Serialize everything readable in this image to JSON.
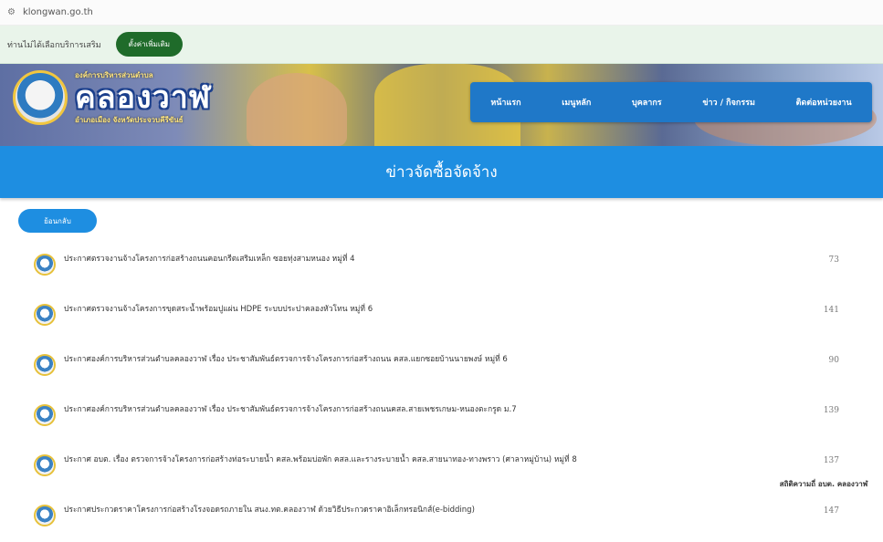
{
  "browser": {
    "url": "klongwan.go.th"
  },
  "notice": {
    "text": "ท่านไม่ได้เลือกบริการเสริม",
    "button": "ตั้งค่าเพิ่มเติม"
  },
  "header": {
    "org_small": "องค์การบริหารส่วนตำบล",
    "org_big": "คลองวาฬ",
    "org_sub": "อำเภอเมือง จังหวัดประจวบคีรีขันธ์"
  },
  "nav": [
    "หน้าแรก",
    "เมนูหลัก",
    "บุคลากร",
    "ข่าว / กิจกรรม",
    "ติดต่อหน่วยงาน"
  ],
  "page": {
    "title": "ข่าวจัดซื้อจัดจ้าง",
    "back_label": "ย้อนกลับ"
  },
  "items": [
    {
      "title": "ประกาศตรวจงานจ้างโครงการก่อสร้างถนนคอนกรีตเสริมเหล็ก ซอยทุ่งสามหนอง หมู่ที่ 4",
      "views": "73"
    },
    {
      "title": "ประกาศตรวจงานจ้างโครงการขุดสระน้ำพร้อมปูแผ่น HDPE ระบบประปาคลองหัวโทน หมู่ที่ 6",
      "views": "141"
    },
    {
      "title": "ประกาศองค์การบริหารส่วนตำบลคลองวาฬ เรื่อง ประชาสัมพันธ์ตรวจการจ้างโครงการก่อสร้างถนน คสล.แยกซอยบ้านนายพงษ์ หมู่ที่ 6",
      "views": "90"
    },
    {
      "title": "ประกาศองค์การบริหารส่วนตำบลคลองวาฬ เรื่อง ประชาสัมพันธ์ตรวจการจ้างโครงการก่อสร้างถนนคสล.สายเพชรเกษม-หนองตะกรูด ม.7",
      "views": "139"
    },
    {
      "title": "ประกาศ อบต. เรื่อง ตรวจการจ้างโครงการก่อสร้างท่อระบายน้ำ คสล.พร้อมบ่อพัก คสล.และรางระบายน้ำ คสล.สายนาทอง-ทางพราว (ศาลาหมู่บ้าน) หมู่ที่ 8",
      "views": "137"
    },
    {
      "title": "ประกาศประกวดราคาโครงการก่อสร้างโรงจอดรถภายใน สนง.ทต.คลองวาฬ ด้วยวิธีประกวดราคาอิเล็กทรอนิกส์(e-bidding)",
      "views": "147"
    }
  ],
  "stats_label": "สถิติความถี่ อบต. คลองวาฬ"
}
